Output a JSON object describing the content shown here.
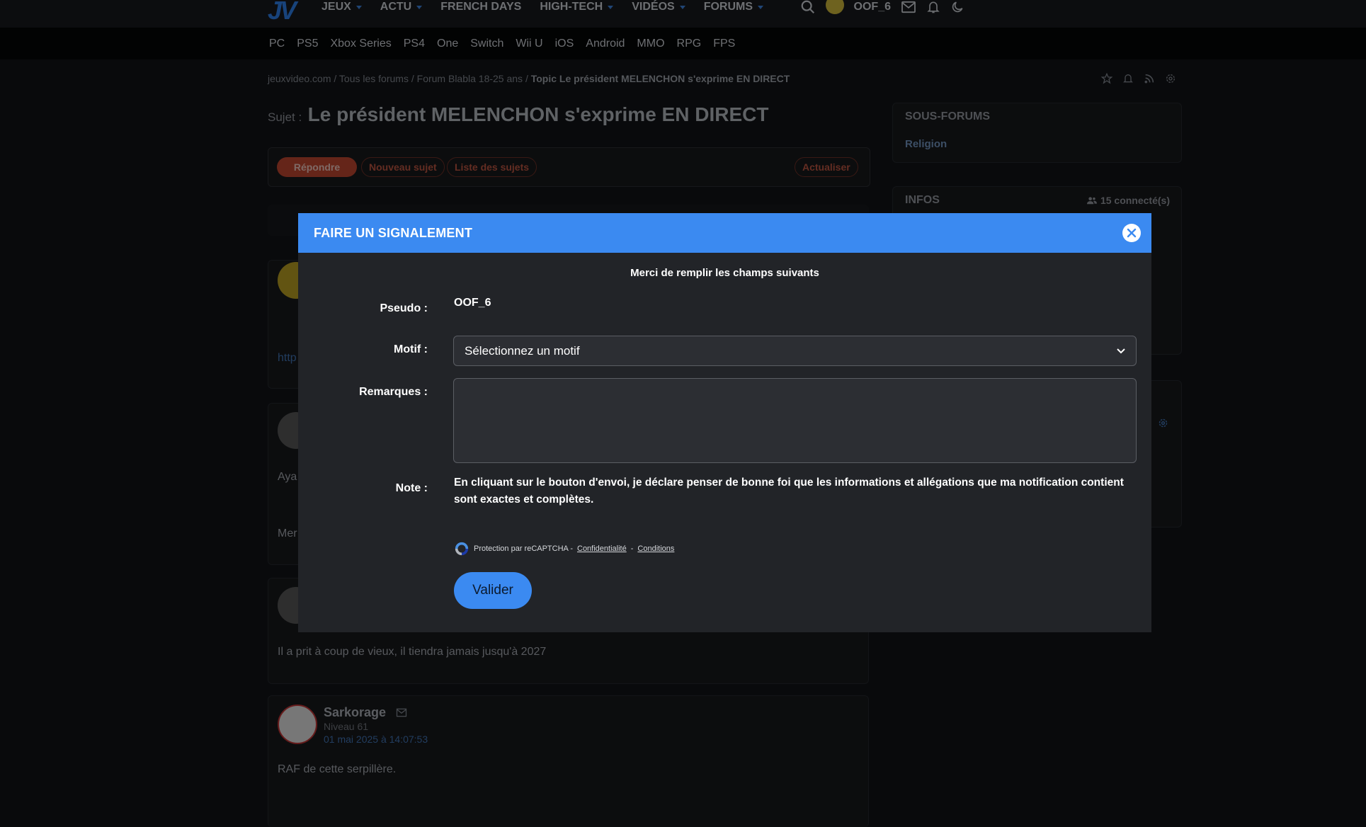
{
  "topnav": {
    "logo": "JV",
    "items": [
      "JEUX",
      "ACTU",
      "FRENCH DAYS",
      "HIGH-TECH",
      "VIDÉOS",
      "FORUMS"
    ],
    "username": "OOF_6"
  },
  "subnav": {
    "items": [
      "PC",
      "PS5",
      "Xbox Series",
      "PS4",
      "One",
      "Switch",
      "Wii U",
      "iOS",
      "Android",
      "MMO",
      "RPG",
      "FPS"
    ]
  },
  "breadcrumb": {
    "site": "jeuxvideo.com",
    "all_forums": "Tous les forums",
    "forum": "Forum Blabla 18-25 ans",
    "topic": "Topic Le président MELENCHON s'exprime EN DIRECT",
    "sep": "/"
  },
  "subject": {
    "label": "Sujet :",
    "title": "Le président MELENCHON s'exprime EN DIRECT"
  },
  "actions": {
    "reply": "Répondre",
    "new_topic": "Nouveau sujet",
    "topic_list": "Liste des sujets",
    "refresh": "Actualiser"
  },
  "posts": [
    {
      "text": "http"
    },
    {
      "text1": "Aya",
      "text2": "Mer"
    },
    {
      "text": "Il a prit à coup de vieux, il tiendra jamais jusqu'à 2027"
    },
    {
      "author": "Sarkorage",
      "level": "Niveau 61",
      "date": "01 mai 2025 à 14:07:53",
      "text": "RAF de cette serpillère."
    }
  ],
  "sidebar": {
    "subforums_title": "SOUS-FORUMS",
    "subforum_item": "Religion",
    "infos_title": "INFOS",
    "connected": "15 connecté(s)"
  },
  "modal": {
    "title": "FAIRE UN SIGNALEMENT",
    "intro": "Merci de remplir les champs suivants",
    "pseudo_label": "Pseudo :",
    "pseudo_value": "OOF_6",
    "motif_label": "Motif :",
    "motif_selected": "Sélectionnez un motif",
    "remarks_label": "Remarques :",
    "remarks_value": "",
    "note_label": "Note :",
    "note_text": "En cliquant sur le bouton d'envoi, je déclare penser de bonne foi que les informations et allégations que ma notification contient sont exactes et complètes.",
    "recaptcha_text": "Protection par reCAPTCHA -",
    "privacy_link": "Confidentialité",
    "recaptcha_sep": "-",
    "terms_link": "Conditions",
    "submit": "Valider"
  },
  "colors": {
    "modal_header": "#3b8af1",
    "reply_button": "#b8442f",
    "page_bg": "#111316"
  }
}
